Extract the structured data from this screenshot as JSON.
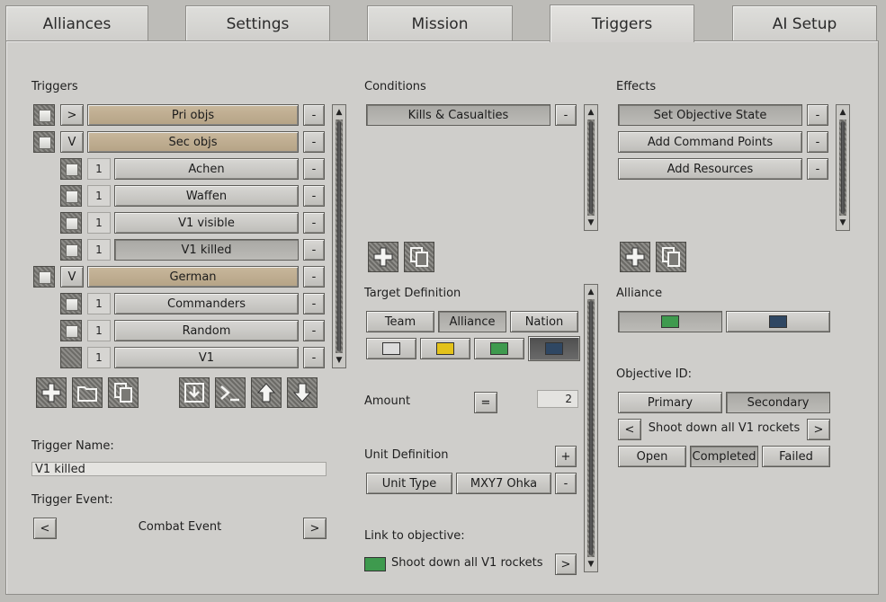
{
  "tabs": [
    {
      "label": "Alliances"
    },
    {
      "label": "Settings"
    },
    {
      "label": "Mission"
    },
    {
      "label": "Triggers"
    },
    {
      "label": "AI Setup"
    }
  ],
  "triggers": {
    "header": "Triggers",
    "rows": [
      {
        "toggle": ">",
        "label": "Pri objs"
      },
      {
        "toggle": "V",
        "label": "Sec objs"
      },
      {
        "num": "1",
        "label": "Achen"
      },
      {
        "num": "1",
        "label": "Waffen"
      },
      {
        "num": "1",
        "label": "V1 visible"
      },
      {
        "num": "1",
        "label": "V1 killed"
      },
      {
        "toggle": "V",
        "label": "German"
      },
      {
        "num": "1",
        "label": "Commanders"
      },
      {
        "num": "1",
        "label": "Random"
      },
      {
        "num": "1",
        "label": "V1"
      }
    ],
    "remove_label": "-",
    "name_label": "Trigger Name:",
    "name_value": "V1 killed",
    "event_label": "Trigger Event:",
    "event_value": "Combat Event",
    "prev": "<",
    "next": ">"
  },
  "conditions": {
    "header": "Conditions",
    "items": [
      "Kills & Casualties"
    ],
    "remove_label": "-",
    "target_def_label": "Target Definition",
    "target_types": [
      "Team",
      "Alliance",
      "Nation"
    ],
    "amount_label": "Amount",
    "amount_op": "=",
    "amount_value": "2",
    "unit_def_label": "Unit Definition",
    "unit_add": "+",
    "unit_type": "Unit Type",
    "unit_value": "MXY7 Ohka",
    "link_label": "Link to objective:",
    "link_value": "Shoot down all V1 rockets",
    "link_next": ">"
  },
  "effects": {
    "header": "Effects",
    "items": [
      "Set Objective State",
      "Add Command Points",
      "Add Resources"
    ],
    "remove_label": "-",
    "alliance_label": "Alliance",
    "objective_label": "Objective ID:",
    "obj_types": [
      "Primary",
      "Secondary"
    ],
    "obj_prev": "<",
    "obj_value": "Shoot down all V1 rockets",
    "obj_next": ">",
    "states": [
      "Open",
      "Completed",
      "Failed"
    ]
  },
  "colors": {
    "white": "#dcdcdc",
    "yellow": "#e3c21a",
    "green": "#3e9a4e",
    "blue": "#2f4763"
  },
  "scrollbar_up": "▲",
  "scrollbar_down": "▼"
}
